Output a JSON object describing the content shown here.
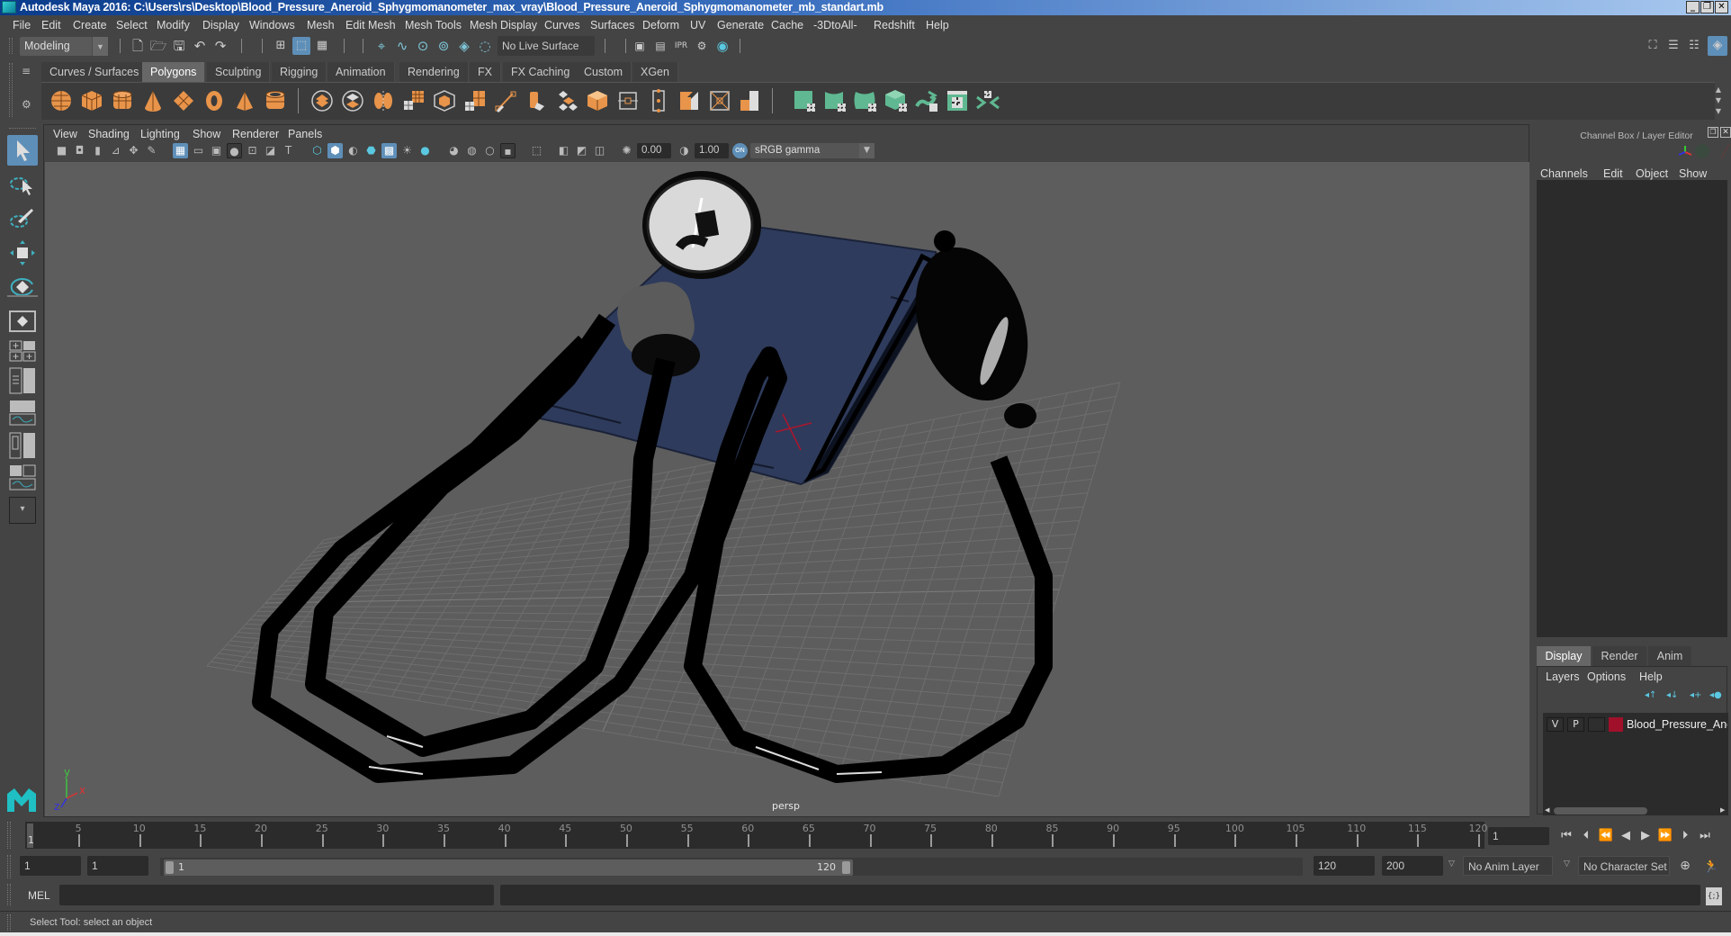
{
  "window": {
    "title": "Autodesk Maya 2016: C:\\Users\\rs\\Desktop\\Blood_Pressure_Aneroid_Sphygmomanometer_max_vray\\Blood_Pressure_Aneroid_Sphygmomanometer_mb_standart.mb",
    "minimize": "_",
    "restore": "❐",
    "close": "✕"
  },
  "menubar": [
    "File",
    "Edit",
    "Create",
    "Select",
    "Modify",
    "Display",
    "Windows",
    "Mesh",
    "Edit Mesh",
    "Mesh Tools",
    "Mesh Display",
    "Curves",
    "Surfaces",
    "Deform",
    "UV",
    "Generate",
    "Cache",
    "-3DtoAll-",
    "Redshift",
    "Help"
  ],
  "statusline": {
    "workspace": "Modeling",
    "live_surface": "No Live Surface",
    "icons": [
      "new-scene-icon",
      "open-scene-icon",
      "save-scene-icon",
      "undo-icon",
      "redo-icon",
      "select-hierarchy-icon",
      "select-object-icon",
      "select-component-icon",
      "snap-grid-icon",
      "snap-curve-icon",
      "snap-point-icon",
      "snap-view-icon",
      "snap-surface-icon",
      "snap-live-icon",
      "render-view-icon",
      "render-frame-icon",
      "ipr-render-icon",
      "render-settings-icon",
      "hypershade-icon"
    ],
    "right_icons": [
      "modeling-toolkit-icon",
      "attribute-editor-icon",
      "tool-settings-icon",
      "channel-box-icon"
    ]
  },
  "shelf": {
    "tabs": [
      "Curves / Surfaces",
      "Polygons",
      "Sculpting",
      "Rigging",
      "Animation",
      "Rendering",
      "FX",
      "FX Caching",
      "Custom",
      "XGen"
    ],
    "active_tab": "Polygons",
    "orange_icons": [
      "poly-sphere-icon",
      "poly-cube-icon",
      "poly-cylinder-icon",
      "poly-cone-icon",
      "poly-plane-icon",
      "poly-torus-icon",
      "poly-pyramid-icon",
      "poly-pipe-icon"
    ],
    "tool_icons": [
      "combine-icon",
      "separate-icon",
      "mirror-icon",
      "smooth-icon",
      "extract-icon",
      "bridge-icon",
      "multi-cut-icon",
      "extrude-icon",
      "bevel-icon",
      "append-icon",
      "fill-hole-icon",
      "merge-icon",
      "edge-loop-icon",
      "quad-draw-icon",
      "triangulate-icon",
      "target-weld-icon",
      "planar-mapping-icon"
    ],
    "uv_icons": [
      "planar-uv-icon",
      "cylindrical-uv-icon",
      "spherical-uv-icon",
      "automatic-uv-icon",
      "unfold-uv-icon",
      "uv-editor-icon",
      "uv-layout-icon"
    ]
  },
  "viewport": {
    "menus": [
      "View",
      "Shading",
      "Lighting",
      "Show",
      "Renderer",
      "Panels"
    ],
    "exposure": "0.00",
    "gamma": "1.00",
    "color_space": "sRGB gamma",
    "camera_label": "persp",
    "axis_labels": {
      "x": "x",
      "y": "y",
      "z": "z"
    }
  },
  "channelbox": {
    "title": "Channel Box / Layer Editor",
    "menus": [
      "Channels",
      "Edit",
      "Object",
      "Show"
    ]
  },
  "layereditor": {
    "tabs": [
      "Display",
      "Render",
      "Anim"
    ],
    "active_tab": "Display",
    "menus": [
      "Layers",
      "Options",
      "Help"
    ],
    "layers": [
      {
        "v": "V",
        "p": "P",
        "color": "#a0102a",
        "name": "Blood_Pressure_Anero"
      }
    ]
  },
  "timeslider": {
    "ticks": [
      5,
      10,
      15,
      20,
      25,
      30,
      35,
      40,
      45,
      50,
      55,
      60,
      65,
      70,
      75,
      80,
      85,
      90,
      95,
      100,
      105,
      110,
      115,
      120
    ],
    "start": 1,
    "end": 120,
    "current_frame": "1",
    "current_label": "1"
  },
  "rangeslider": {
    "start_time": "1",
    "playback_start": "1",
    "range_start_label": "1",
    "range_end_label": "120",
    "playback_end": "120",
    "end_time": "200",
    "anim_layer": "No Anim Layer",
    "character_set": "No Character Set"
  },
  "commandline": {
    "label": "MEL",
    "input": "",
    "output": ""
  },
  "helpline": {
    "text": "Select Tool: select an object"
  }
}
